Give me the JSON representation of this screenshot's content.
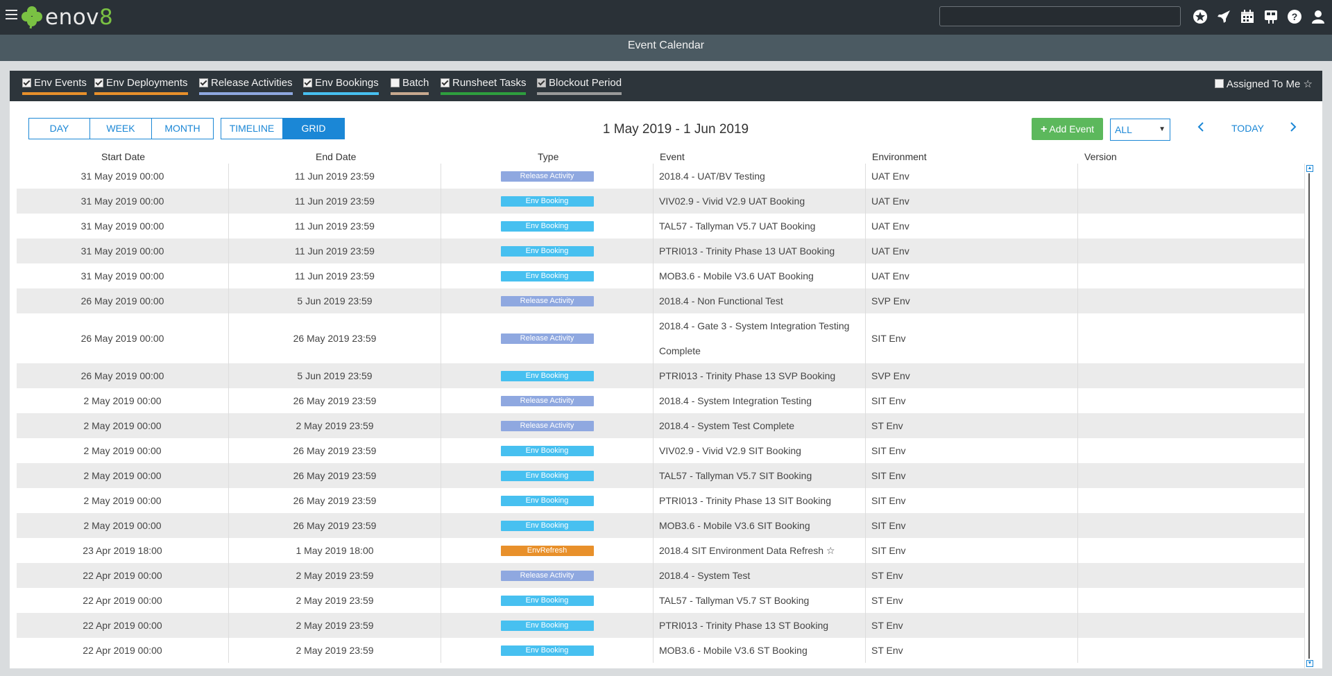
{
  "app": {
    "logo_prefix": "enov",
    "logo_suffix": "8"
  },
  "search": {
    "placeholder": ""
  },
  "header": {
    "title": "Event Calendar"
  },
  "filters": [
    {
      "label": "Env Events",
      "checked": true,
      "color": "#e8902b"
    },
    {
      "label": "Env Deployments",
      "checked": true,
      "color": "#e8902b"
    },
    {
      "label": "Release Activities",
      "checked": true,
      "color": "#8fa8e0"
    },
    {
      "label": "Env Bookings",
      "checked": true,
      "color": "#47c0f0"
    },
    {
      "label": "Batch",
      "checked": false,
      "color": "#c8a98f"
    },
    {
      "label": "Runsheet Tasks",
      "checked": true,
      "color": "#2e9e3e"
    },
    {
      "label": "Blockout Period",
      "checked": false,
      "color": "#9a9a9a"
    }
  ],
  "assigned_to_me": {
    "label": "Assigned To Me ☆",
    "checked": false
  },
  "views": {
    "day": "DAY",
    "week": "WEEK",
    "month": "MONTH",
    "timeline": "TIMELINE",
    "grid": "GRID"
  },
  "range_label": "1 May 2019 - 1 Jun 2019",
  "add_event": "Add Event",
  "filter_select": "ALL",
  "today": "TODAY",
  "table": {
    "headers": [
      "Start Date",
      "End Date",
      "Type",
      "Event",
      "Environment",
      "Version"
    ],
    "type_colors": {
      "Release Activity": "#8fa8e0",
      "Env Booking": "#47c0f0",
      "EnvRefresh": "#e8902b"
    },
    "rows": [
      {
        "start": "31 May 2019 00:00",
        "end": "11 Jun 2019 23:59",
        "type": "Release Activity",
        "event": "2018.4 - UAT/BV Testing",
        "env": "UAT Env",
        "version": ""
      },
      {
        "start": "31 May 2019 00:00",
        "end": "11 Jun 2019 23:59",
        "type": "Env Booking",
        "event": "VIV02.9 - Vivid V2.9 UAT Booking",
        "env": "UAT Env",
        "version": ""
      },
      {
        "start": "31 May 2019 00:00",
        "end": "11 Jun 2019 23:59",
        "type": "Env Booking",
        "event": "TAL57 - Tallyman V5.7 UAT Booking",
        "env": "UAT Env",
        "version": ""
      },
      {
        "start": "31 May 2019 00:00",
        "end": "11 Jun 2019 23:59",
        "type": "Env Booking",
        "event": "PTRI013 - Trinity Phase 13 UAT Booking",
        "env": "UAT Env",
        "version": ""
      },
      {
        "start": "31 May 2019 00:00",
        "end": "11 Jun 2019 23:59",
        "type": "Env Booking",
        "event": "MOB3.6 - Mobile V3.6 UAT Booking",
        "env": "UAT Env",
        "version": ""
      },
      {
        "start": "26 May 2019 00:00",
        "end": "5 Jun 2019 23:59",
        "type": "Release Activity",
        "event": "2018.4 - Non Functional Test",
        "env": "SVP Env",
        "version": ""
      },
      {
        "start": "26 May 2019 00:00",
        "end": "26 May 2019 23:59",
        "type": "Release Activity",
        "event": "2018.4 - Gate 3 - System Integration Testing Complete",
        "env": "SIT Env",
        "version": ""
      },
      {
        "start": "26 May 2019 00:00",
        "end": "5 Jun 2019 23:59",
        "type": "Env Booking",
        "event": "PTRI013 - Trinity Phase 13 SVP Booking",
        "env": "SVP Env",
        "version": ""
      },
      {
        "start": "2 May 2019 00:00",
        "end": "26 May 2019 23:59",
        "type": "Release Activity",
        "event": "2018.4 - System Integration Testing",
        "env": "SIT Env",
        "version": ""
      },
      {
        "start": "2 May 2019 00:00",
        "end": "2 May 2019 23:59",
        "type": "Release Activity",
        "event": "2018.4 - System Test Complete",
        "env": "ST Env",
        "version": ""
      },
      {
        "start": "2 May 2019 00:00",
        "end": "26 May 2019 23:59",
        "type": "Env Booking",
        "event": "VIV02.9 - Vivid V2.9 SIT Booking",
        "env": "SIT Env",
        "version": ""
      },
      {
        "start": "2 May 2019 00:00",
        "end": "26 May 2019 23:59",
        "type": "Env Booking",
        "event": "TAL57 - Tallyman V5.7 SIT Booking",
        "env": "SIT Env",
        "version": ""
      },
      {
        "start": "2 May 2019 00:00",
        "end": "26 May 2019 23:59",
        "type": "Env Booking",
        "event": "PTRI013 - Trinity Phase 13 SIT Booking",
        "env": "SIT Env",
        "version": ""
      },
      {
        "start": "2 May 2019 00:00",
        "end": "26 May 2019 23:59",
        "type": "Env Booking",
        "event": "MOB3.6 - Mobile V3.6 SIT Booking",
        "env": "SIT Env",
        "version": ""
      },
      {
        "start": "23 Apr 2019 18:00",
        "end": "1 May 2019 18:00",
        "type": "EnvRefresh",
        "event": "2018.4 SIT Environment Data Refresh ☆",
        "env": "SIT Env",
        "version": ""
      },
      {
        "start": "22 Apr 2019 00:00",
        "end": "2 May 2019 23:59",
        "type": "Release Activity",
        "event": "2018.4 - System Test",
        "env": "ST Env",
        "version": ""
      },
      {
        "start": "22 Apr 2019 00:00",
        "end": "2 May 2019 23:59",
        "type": "Env Booking",
        "event": "TAL57 - Tallyman V5.7 ST Booking",
        "env": "ST Env",
        "version": ""
      },
      {
        "start": "22 Apr 2019 00:00",
        "end": "2 May 2019 23:59",
        "type": "Env Booking",
        "event": "PTRI013 - Trinity Phase 13 ST Booking",
        "env": "ST Env",
        "version": ""
      },
      {
        "start": "22 Apr 2019 00:00",
        "end": "2 May 2019 23:59",
        "type": "Env Booking",
        "event": "MOB3.6 - Mobile V3.6 ST Booking",
        "env": "ST Env",
        "version": ""
      }
    ]
  }
}
